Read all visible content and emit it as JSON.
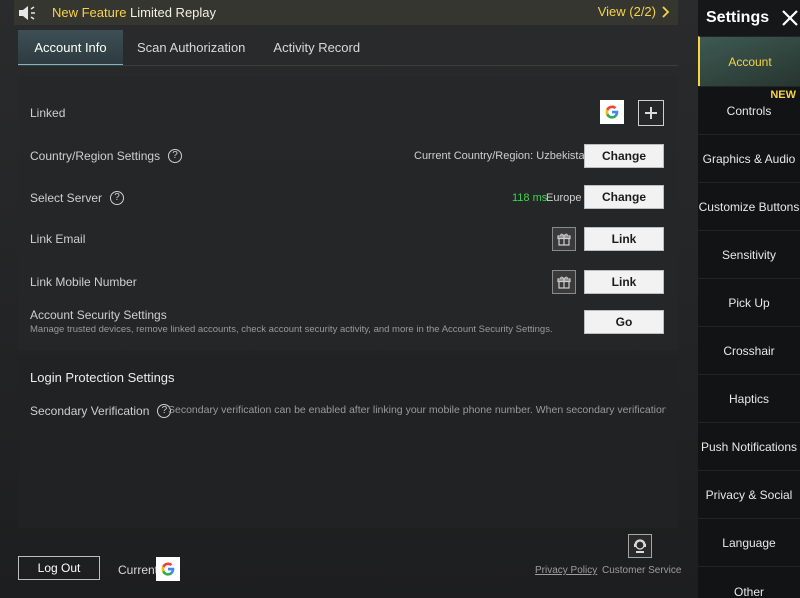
{
  "banner": {
    "title_highlight": "New Feature",
    "title_rest": " Limited Replay",
    "view": "View (2/2)"
  },
  "tabs": [
    {
      "label": "Account Info",
      "active": true
    },
    {
      "label": "Scan Authorization",
      "active": false
    },
    {
      "label": "Activity Record",
      "active": false
    }
  ],
  "account": {
    "linked_label": "Linked",
    "country_label": "Country/Region Settings",
    "country_current": "Current Country/Region: Uzbekistan",
    "country_button": "Change",
    "server_label": "Select Server",
    "server_ping": "118 ms",
    "server_region": "Europe",
    "server_button": "Change",
    "email_label": "Link Email",
    "email_button": "Link",
    "mobile_label": "Link Mobile Number",
    "mobile_button": "Link",
    "security_label": "Account Security Settings",
    "security_desc": "Manage trusted devices, remove linked accounts, check account security activity, and more in the Account Security Settings.",
    "security_button": "Go"
  },
  "login_protection": {
    "title": "Login Protection Settings",
    "secondary_label": "Secondary Verification",
    "secondary_desc": "Secondary verification can be enabled after linking your mobile phone number. When secondary verification is enabled,"
  },
  "sidebar": {
    "title": "Settings",
    "new_badge": "NEW",
    "items": [
      {
        "label": "Account",
        "active": true
      },
      {
        "label": "Controls",
        "active": false
      },
      {
        "label": "Graphics & Audio",
        "active": false
      },
      {
        "label": "Customize Buttons",
        "active": false
      },
      {
        "label": "Sensitivity",
        "active": false
      },
      {
        "label": "Pick Up",
        "active": false
      },
      {
        "label": "Crosshair",
        "active": false
      },
      {
        "label": "Haptics",
        "active": false
      },
      {
        "label": "Push Notifications",
        "active": false
      },
      {
        "label": "Privacy & Social",
        "active": false
      },
      {
        "label": "Language",
        "active": false
      },
      {
        "label": "Other",
        "active": false
      }
    ]
  },
  "footer": {
    "logout": "Log Out",
    "current_label": "Current",
    "privacy_policy": "Privacy Policy",
    "customer_service": "Customer Service"
  },
  "colors": {
    "accent_yellow": "#f7d348",
    "ping_green": "#3dd44a",
    "google_blue": "#4285f4",
    "google_red": "#ea4335",
    "google_yellow": "#fbbc05",
    "google_green": "#34a853"
  },
  "icons": [
    "speaker-icon",
    "chevron-right-icon",
    "close-icon",
    "google-icon",
    "plus-icon",
    "help-icon",
    "gift-icon",
    "customer-service-icon"
  ]
}
